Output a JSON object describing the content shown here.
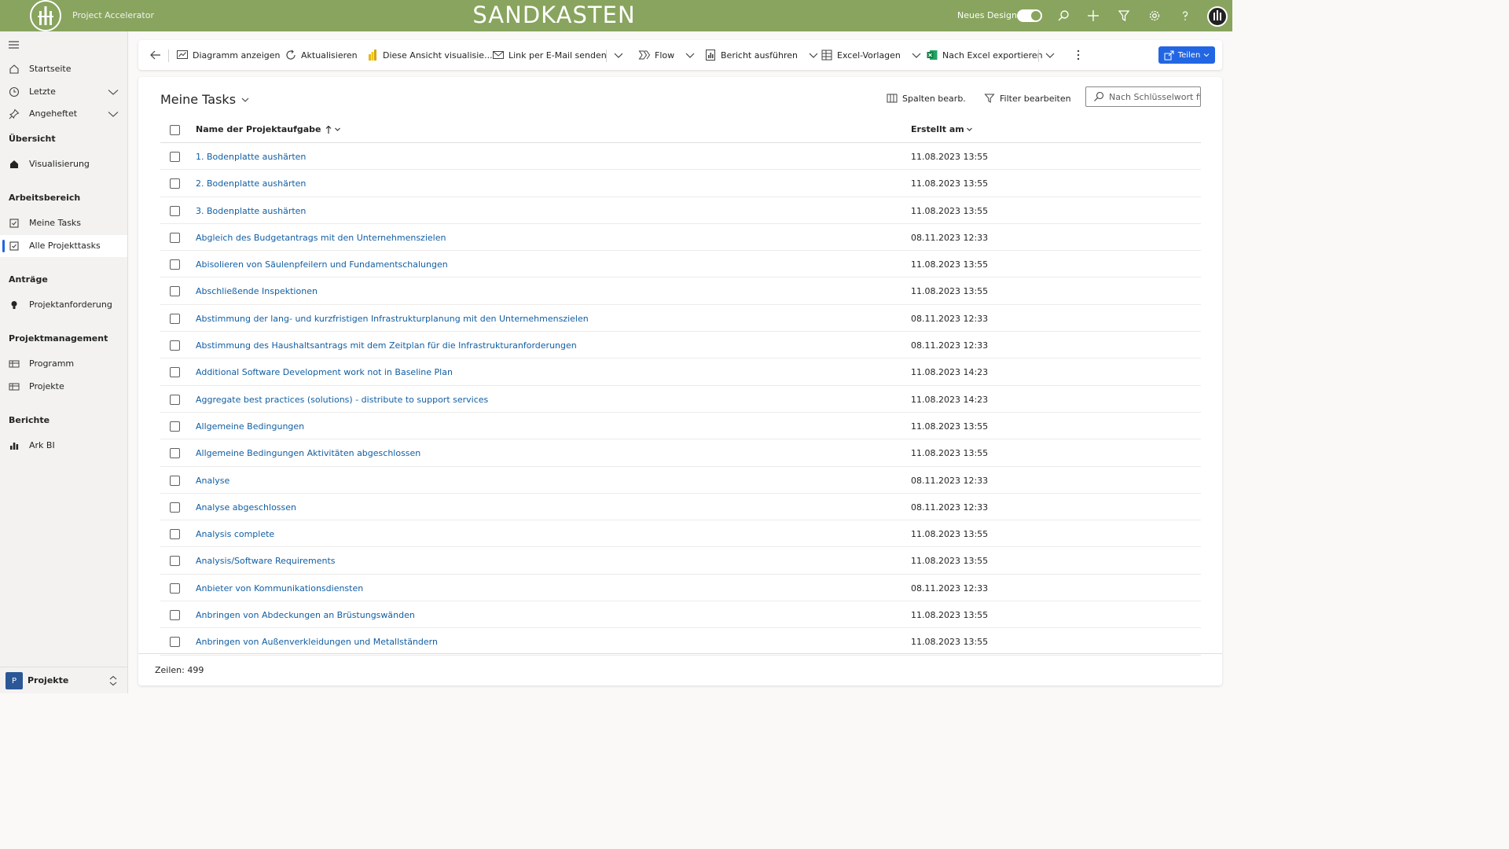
{
  "header": {
    "app_name": "Project Accelerator",
    "environment": "SANDKASTEN",
    "design_toggle_label": "Neues Design",
    "design_toggle_on": true,
    "accent_color": "#88a45e"
  },
  "sidebar": {
    "items": [
      {
        "label": "Startseite",
        "icon": "home-outline-icon"
      },
      {
        "label": "Letzte",
        "icon": "clock-icon"
      },
      {
        "label": "Angeheftet",
        "icon": "pin-icon"
      }
    ],
    "sections": [
      {
        "title": "Übersicht",
        "items": [
          {
            "label": "Visualisierung",
            "icon": "home-filled-icon"
          }
        ]
      },
      {
        "title": "Arbeitsbereich",
        "items": [
          {
            "label": "Meine Tasks",
            "icon": "task-icon"
          },
          {
            "label": "Alle Projekttasks",
            "icon": "task-icon",
            "active": true
          }
        ]
      },
      {
        "title": "Anträge",
        "items": [
          {
            "label": "Projektanforderung",
            "icon": "lightbulb-icon"
          }
        ]
      },
      {
        "title": "Projektmanagement",
        "items": [
          {
            "label": "Programm",
            "icon": "table-icon"
          },
          {
            "label": "Projekte",
            "icon": "table-icon"
          }
        ]
      },
      {
        "title": "Berichte",
        "items": [
          {
            "label": "Ark BI",
            "icon": "bar-chart-icon"
          }
        ]
      }
    ],
    "area": {
      "badge": "P",
      "label": "Projekte"
    }
  },
  "commands": {
    "show_chart": "Diagramm anzeigen",
    "refresh": "Aktualisieren",
    "visualize": "Diese Ansicht visualisie...",
    "email_link": "Link per E-Mail senden",
    "flow": "Flow",
    "run_report": "Bericht ausführen",
    "excel_templates": "Excel-Vorlagen",
    "export_excel": "Nach Excel exportieren",
    "share": "Teilen"
  },
  "view": {
    "title": "Meine Tasks",
    "edit_columns": "Spalten bearb.",
    "edit_filters": "Filter bearbeiten",
    "search_placeholder": "Nach Schlüsselwort fil...",
    "columns": {
      "name": "Name der Projektaufgabe",
      "created": "Erstellt am"
    },
    "rows": [
      {
        "name": "1. Bodenplatte aushärten",
        "created": "11.08.2023 13:55"
      },
      {
        "name": "2. Bodenplatte aushärten",
        "created": "11.08.2023 13:55"
      },
      {
        "name": "3. Bodenplatte aushärten",
        "created": "11.08.2023 13:55"
      },
      {
        "name": "Abgleich des Budgetantrags mit den Unternehmenszielen",
        "created": "08.11.2023 12:33"
      },
      {
        "name": "Abisolieren von Säulenpfeilern und Fundamentschalungen",
        "created": "11.08.2023 13:55"
      },
      {
        "name": "Abschließende Inspektionen",
        "created": "11.08.2023 13:55"
      },
      {
        "name": "Abstimmung der lang- und kurzfristigen Infrastrukturplanung mit den Unternehmenszielen",
        "created": "08.11.2023 12:33"
      },
      {
        "name": "Abstimmung des Haushaltsantrags mit dem Zeitplan für die Infrastrukturanforderungen",
        "created": "08.11.2023 12:33"
      },
      {
        "name": "Additional Software Development work not in Baseline Plan",
        "created": "11.08.2023 14:23"
      },
      {
        "name": "Aggregate best practices (solutions) - distribute to support services",
        "created": "11.08.2023 14:23"
      },
      {
        "name": "Allgemeine Bedingungen",
        "created": "11.08.2023 13:55"
      },
      {
        "name": "Allgemeine Bedingungen Aktivitäten abgeschlossen",
        "created": "11.08.2023 13:55"
      },
      {
        "name": "Analyse",
        "created": "08.11.2023 12:33"
      },
      {
        "name": "Analyse abgeschlossen",
        "created": "08.11.2023 12:33"
      },
      {
        "name": "Analysis complete",
        "created": "11.08.2023 13:55"
      },
      {
        "name": "Analysis/Software Requirements",
        "created": "11.08.2023 13:55"
      },
      {
        "name": "Anbieter von Kommunikationsdiensten",
        "created": "08.11.2023 12:33"
      },
      {
        "name": "Anbringen von Abdeckungen an Brüstungswänden",
        "created": "11.08.2023 13:55"
      },
      {
        "name": "Anbringen von Außenverkleidungen und Metallständern",
        "created": "11.08.2023 13:55"
      }
    ],
    "row_count": "Zeilen: 499"
  }
}
